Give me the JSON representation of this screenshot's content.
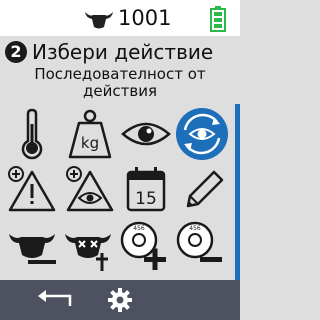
{
  "status": {
    "animal_id": "1001",
    "head_icon": "cow-head-icon",
    "battery_icon": "battery-full-icon",
    "battery_color": "#2eb84a"
  },
  "header": {
    "step": "2",
    "title": "Избери действие",
    "subtitle": "Последователност от действия"
  },
  "actions": [
    {
      "icon": "thermometer-icon"
    },
    {
      "icon": "weight-kg-icon",
      "text": "kg"
    },
    {
      "icon": "eye-icon"
    },
    {
      "icon": "eye-cycle-icon",
      "selected": true,
      "selected_color": "#1c6fb8"
    },
    {
      "icon": "warning-plus-icon"
    },
    {
      "icon": "eye-warning-plus-icon"
    },
    {
      "icon": "calendar-icon",
      "text": "15"
    },
    {
      "icon": "pencil-icon"
    },
    {
      "icon": "cow-remove-icon"
    },
    {
      "icon": "cow-dead-icon"
    },
    {
      "icon": "ear-tag-add-icon",
      "text": "456"
    },
    {
      "icon": "ear-tag-remove-icon",
      "text": "456"
    }
  ],
  "navbar": {
    "back_icon": "back-arrow-icon",
    "settings_icon": "gear-icon",
    "background": "#4d5160"
  }
}
